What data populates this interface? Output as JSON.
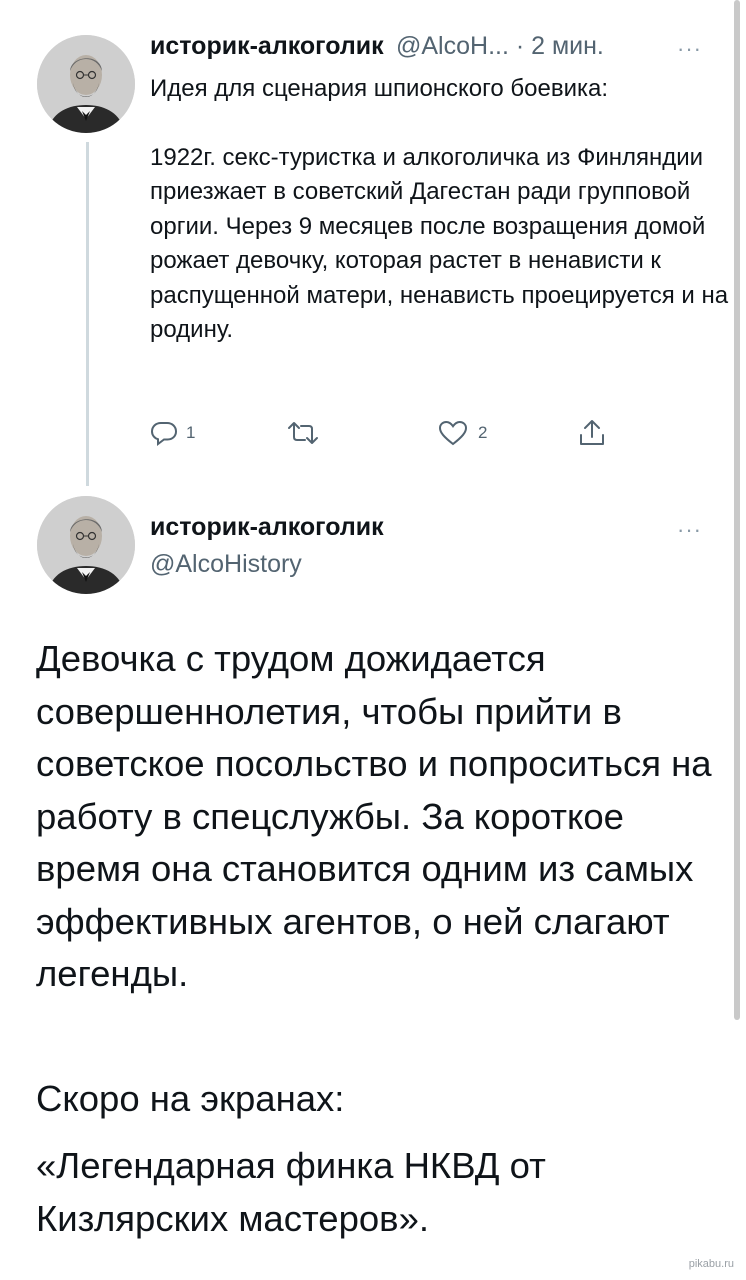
{
  "tweet1": {
    "display_name": "историк-алкоголик",
    "handle_time": "@AlcoH... · 2 мин.",
    "more": "···",
    "paragraphs": [
      "Идея для сценария шпионского боевика:",
      "1922г. секс-туристка и алкоголичка из Финляндии приезжает в советский Дагестан ради групповой оргии. Через 9 месяцев после возращения домой рожает девочку, которая растет в ненависти к распущенной матери, ненависть проецируется и на родину."
    ],
    "actions": {
      "reply_icon": "reply-icon",
      "reply_count": "1",
      "retweet_icon": "retweet-icon",
      "like_icon": "heart-icon",
      "like_count": "2",
      "share_icon": "share-icon"
    }
  },
  "tweet2": {
    "display_name": "историк-алкоголик",
    "handle": "@AlcoHistory",
    "more": "···",
    "paragraphs": [
      "Девочка с трудом дожидается совершеннолетия, чтобы прийти в советское посольство и попроситься на работу в спецслужбы. За короткое время она становится одним из самых эффективных агентов, о ней слагают легенды.",
      "Скоро на экранах:",
      "«Легендарная финка НКВД от Кизлярских мастеров»."
    ]
  },
  "watermark": "pikabu.ru",
  "colors": {
    "text": "#0f1419",
    "secondary": "#536471",
    "thread_line": "#cfd9de"
  }
}
